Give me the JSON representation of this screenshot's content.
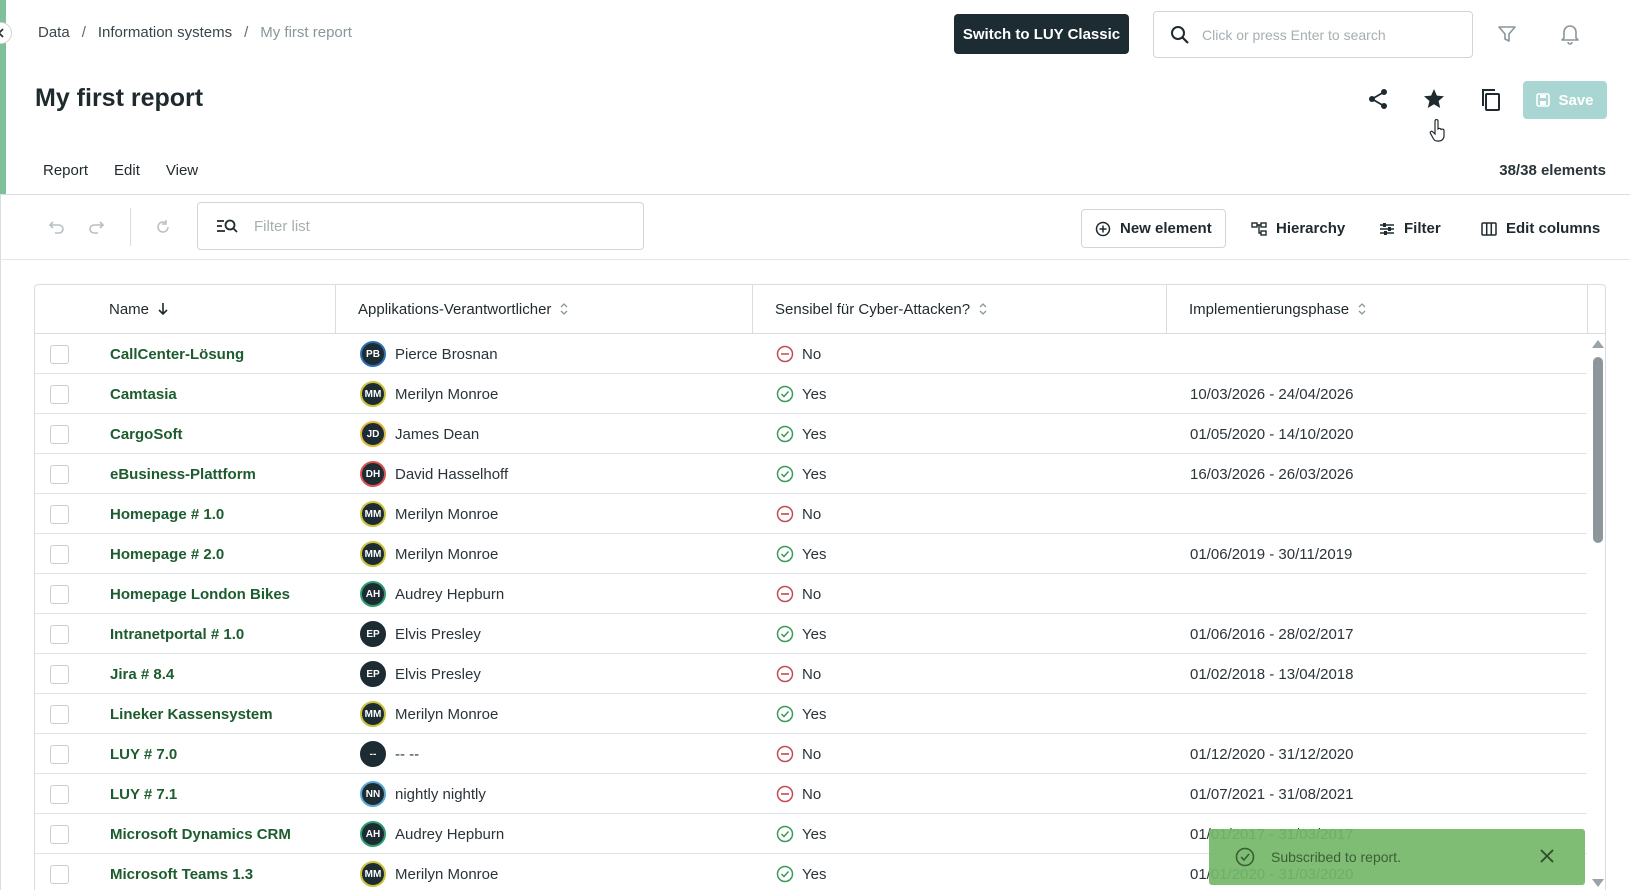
{
  "breadcrumb": {
    "items": [
      "Data",
      "Information systems"
    ],
    "separator": "/",
    "current": "My first report"
  },
  "header": {
    "switch_button_label": "Switch to LUY Classic",
    "search_placeholder": "Click or press Enter to search",
    "icons": [
      "search-icon",
      "filter-icon",
      "bell-icon"
    ]
  },
  "page": {
    "title": "My first report",
    "actions": [
      "share-icon",
      "star-icon",
      "copy-icon"
    ],
    "save_label": "Save"
  },
  "menu": {
    "items": [
      "Report",
      "Edit",
      "View"
    ],
    "element_count": "38/38 elements"
  },
  "toolbar": {
    "filter_placeholder": "Filter list",
    "new_element_label": "New element",
    "hierarchy_label": "Hierarchy",
    "filter_label": "Filter",
    "edit_columns_label": "Edit columns"
  },
  "table": {
    "columns": [
      "Name",
      "Applikations-Verantwortlicher",
      "Sensibel für Cyber-Attacken?",
      "Implementierungsphase"
    ],
    "rows": [
      {
        "name": "CallCenter-Lösung",
        "initials": "PB",
        "owner": "Pierce Brosnan",
        "ring": "#2f6fb5",
        "sensitive": "No",
        "phase": ""
      },
      {
        "name": "Camtasia",
        "initials": "MM",
        "owner": "Merilyn Monroe",
        "ring": "#c9c23a",
        "sensitive": "Yes",
        "phase": "10/03/2026 - 24/04/2026"
      },
      {
        "name": "CargoSoft",
        "initials": "JD",
        "owner": "James Dean",
        "ring": "#e2b53a",
        "sensitive": "Yes",
        "phase": "01/05/2020 - 14/10/2020"
      },
      {
        "name": "eBusiness-Plattform",
        "initials": "DH",
        "owner": "David Hasselhoff",
        "ring": "#d9534f",
        "sensitive": "Yes",
        "phase": "16/03/2026 - 26/03/2026"
      },
      {
        "name": "Homepage # 1.0",
        "initials": "MM",
        "owner": "Merilyn Monroe",
        "ring": "#c9c23a",
        "sensitive": "No",
        "phase": ""
      },
      {
        "name": "Homepage # 2.0",
        "initials": "MM",
        "owner": "Merilyn Monroe",
        "ring": "#c9c23a",
        "sensitive": "Yes",
        "phase": "01/06/2019 - 30/11/2019"
      },
      {
        "name": "Homepage London Bikes",
        "initials": "AH",
        "owner": "Audrey Hepburn",
        "ring": "#2f9e6e",
        "sensitive": "No",
        "phase": ""
      },
      {
        "name": "Intranetportal # 1.0",
        "initials": "EP",
        "owner": "Elvis Presley",
        "ring": "#1d2b33",
        "sensitive": "Yes",
        "phase": "01/06/2016 - 28/02/2017"
      },
      {
        "name": "Jira # 8.4",
        "initials": "EP",
        "owner": "Elvis Presley",
        "ring": "#1d2b33",
        "sensitive": "No",
        "phase": "01/02/2018 - 13/04/2018"
      },
      {
        "name": "Lineker Kassensystem",
        "initials": "MM",
        "owner": "Merilyn Monroe",
        "ring": "#c9c23a",
        "sensitive": "Yes",
        "phase": ""
      },
      {
        "name": "LUY # 7.0",
        "initials": "--",
        "owner": "-- --",
        "ring": "#1d2b33",
        "sensitive": "No",
        "phase": "01/12/2020 - 31/12/2020"
      },
      {
        "name": "LUY # 7.1",
        "initials": "NN",
        "owner": "nightly nightly",
        "ring": "#5aa9d6",
        "sensitive": "No",
        "phase": "01/07/2021 - 31/08/2021"
      },
      {
        "name": "Microsoft Dynamics CRM",
        "initials": "AH",
        "owner": "Audrey Hepburn",
        "ring": "#2f9e6e",
        "sensitive": "Yes",
        "phase": "01/01/2017 - 31/03/2017"
      },
      {
        "name": "Microsoft Teams 1.3",
        "initials": "MM",
        "owner": "Merilyn Monroe",
        "ring": "#c9c23a",
        "sensitive": "Yes",
        "phase": "01/01/2020 - 31/03/2020"
      }
    ]
  },
  "toast": {
    "message": "Subscribed to report."
  },
  "colors": {
    "yes": "#3a9a5a",
    "no": "#c24a52"
  }
}
